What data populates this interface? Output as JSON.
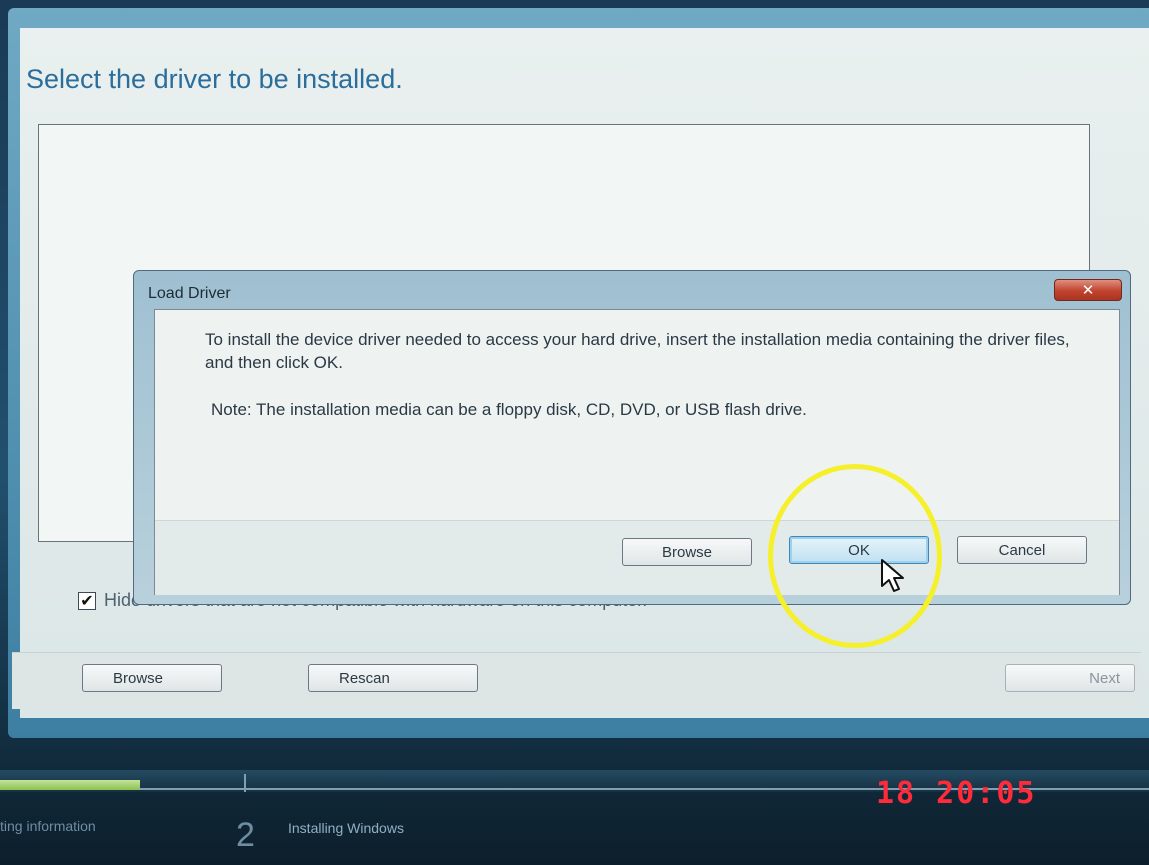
{
  "setup": {
    "page_title": "Select the driver to be installed.",
    "hide_checkbox_checked": true,
    "hide_checkbox_label": "Hide drivers that are not compatible with hardware on this computer.",
    "buttons": {
      "browse": "Browse",
      "rescan": "Rescan",
      "next": "Next"
    }
  },
  "dialog": {
    "title": "Load Driver",
    "close_glyph": "✕",
    "message": "To install the device driver needed to access your hard drive, insert the installation media containing the driver files, and then click OK.",
    "note": "Note: The installation media can be a floppy disk, CD, DVD, or USB flash drive.",
    "buttons": {
      "browse": "Browse",
      "ok": "OK",
      "cancel": "Cancel"
    }
  },
  "progress": {
    "previous_step_label": "ting information",
    "current_step_number": "2",
    "current_step_label": "Installing Windows"
  },
  "overlay": {
    "timestamp": "18  20:05",
    "highlight_color": "#f5f02a"
  },
  "colors": {
    "title_blue": "#2b6e9c",
    "timestamp_red": "#ff2a3a",
    "close_red": "#c1432e"
  }
}
